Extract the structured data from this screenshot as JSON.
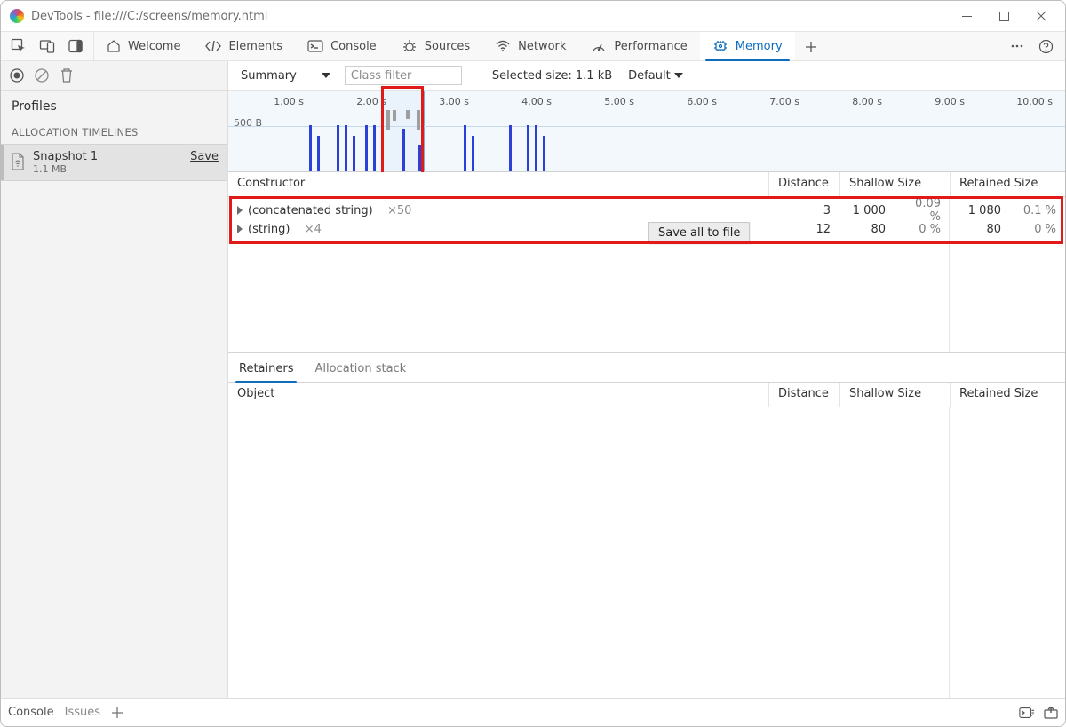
{
  "window": {
    "title": "DevTools - file:///C:/screens/memory.html"
  },
  "tabs": {
    "welcome": "Welcome",
    "elements": "Elements",
    "console": "Console",
    "sources": "Sources",
    "network": "Network",
    "performance": "Performance",
    "memory": "Memory"
  },
  "sidebar": {
    "profiles": "Profiles",
    "timelines": "ALLOCATION TIMELINES",
    "snapshot_name": "Snapshot 1",
    "snapshot_size": "1.1 MB",
    "save": "Save"
  },
  "filterbar": {
    "view": "Summary",
    "class_filter_placeholder": "Class filter",
    "selected_size_label": "Selected size:",
    "selected_size_value": "1.1 kB",
    "group": "Default"
  },
  "overview": {
    "ticks": [
      "1.00 s",
      "2.00 s",
      "3.00 s",
      "4.00 s",
      "5.00 s",
      "6.00 s",
      "7.00 s",
      "8.00 s",
      "9.00 s",
      "10.00 s"
    ],
    "ylabel": "500 B"
  },
  "columns": {
    "constructor": "Constructor",
    "distance": "Distance",
    "shallow": "Shallow Size",
    "retained": "Retained Size",
    "object": "Object"
  },
  "rows": [
    {
      "name": "(concatenated string)",
      "count": "×50",
      "distance": "3",
      "shallow": "1 000",
      "shallow_pct": "0.09 %",
      "retained": "1 080",
      "retained_pct": "0.1 %"
    },
    {
      "name": "(string)",
      "count": "×4",
      "distance": "12",
      "shallow": "80",
      "shallow_pct": "0 %",
      "retained": "80",
      "retained_pct": "0 %"
    }
  ],
  "tooltip": "Save all to file",
  "subtabs": {
    "retainers": "Retainers",
    "alloc_stack": "Allocation stack"
  },
  "footer": {
    "console": "Console",
    "issues": "Issues"
  }
}
